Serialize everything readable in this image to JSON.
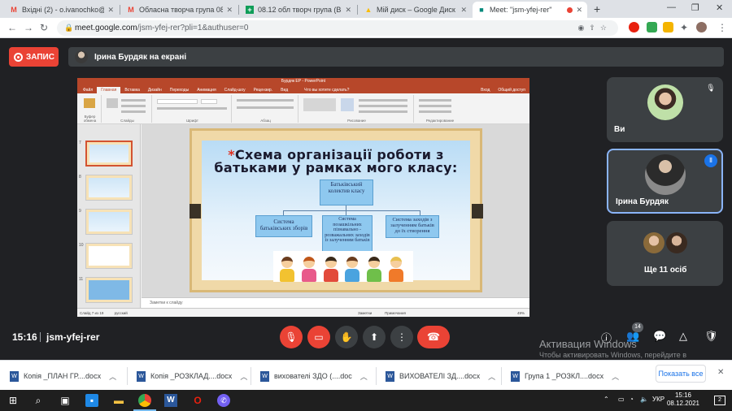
{
  "browser": {
    "tabs": [
      {
        "label": "Вхідні (2) - o.ivanochko@ippo",
        "icon": "gmail-icon",
        "active": false
      },
      {
        "label": "Обласна творча група 08.12",
        "icon": "gmail-icon",
        "active": false
      },
      {
        "label": "08.12 обл творч група (Відп",
        "icon": "google-sheets-icon",
        "active": false
      },
      {
        "label": "Мій диск – Google Диск",
        "icon": "google-drive-icon",
        "active": false
      },
      {
        "label": "Meet: \"jsm-yfej-rer\"",
        "icon": "google-meet-icon",
        "active": true
      }
    ],
    "url_host": "meet.google.com",
    "url_path": "/jsm-yfej-rer?pli=1&authuser=0"
  },
  "meet": {
    "record_label": "ЗАПИС",
    "presenter_banner": "Ірина Бурдяк на екрані",
    "time": "15:16",
    "meeting_code": "jsm-yfej-rer",
    "participants_badge": "14",
    "tiles": [
      {
        "name": "Ви",
        "muted": true
      },
      {
        "name": "Ірина Бурдяк",
        "speaking": true
      },
      {
        "name": "Ще 11 осіб"
      }
    ]
  },
  "slide": {
    "app_title": "Бурдяк ЕР - PowerPoint",
    "ribbon_tabs": [
      "Файл",
      "Главная",
      "Вставка",
      "Дизайн",
      "Переходы",
      "Анимация",
      "Слайд-шоу",
      "Рецензир.",
      "Вид"
    ],
    "tell_me": "Что вы хотите сделать?",
    "account": "Вход",
    "share": "Общий доступ",
    "ribbon_groups": [
      "Буфер обмена",
      "Слайды",
      "Шрифт",
      "Абзац",
      "Рисование",
      "Редактирование"
    ],
    "thumb_numbers": [
      "7",
      "8",
      "9",
      "10",
      "11"
    ],
    "title_star": "*",
    "title": "Схема організації роботи з батьками у рамках мого  класу:",
    "box_top": "Батьківський колектив класу",
    "box_left": "Система батьківських зборів",
    "box_mid": "Система позашкільних пізнавально - розважальних заходів із залученням батьків",
    "box_right": "Система заходів з залученням батьків до їх створення",
    "notes": "Заметки к слайду",
    "status_left": "Слайд 7 из 19",
    "status_lang": "русский",
    "status_notes": "Заметки",
    "status_comments": "Примечания",
    "zoom": "49%"
  },
  "os": {
    "watermark_title": "Активация Windows",
    "watermark_text": "Чтобы активировать Windows, перейдите в раздел \"Параметры\".",
    "lang": "УКР",
    "clock_time": "15:16",
    "clock_date": "08.12.2021",
    "notif_count": "2"
  },
  "downloads": {
    "items": [
      "Копія _ПЛАН ГР....docx",
      "Копія _РОЗКЛАД....docx",
      "вихователі ЗДО (....doc",
      "ВИХОВАТЕЛІ ЗД....docx",
      "Група 1 _РОЗКЛ....docx"
    ],
    "show_all": "Показать все"
  },
  "colors": {
    "meet_red": "#ea4335",
    "powerpoint_accent": "#b7472a",
    "meet_blue": "#1a73e8"
  }
}
